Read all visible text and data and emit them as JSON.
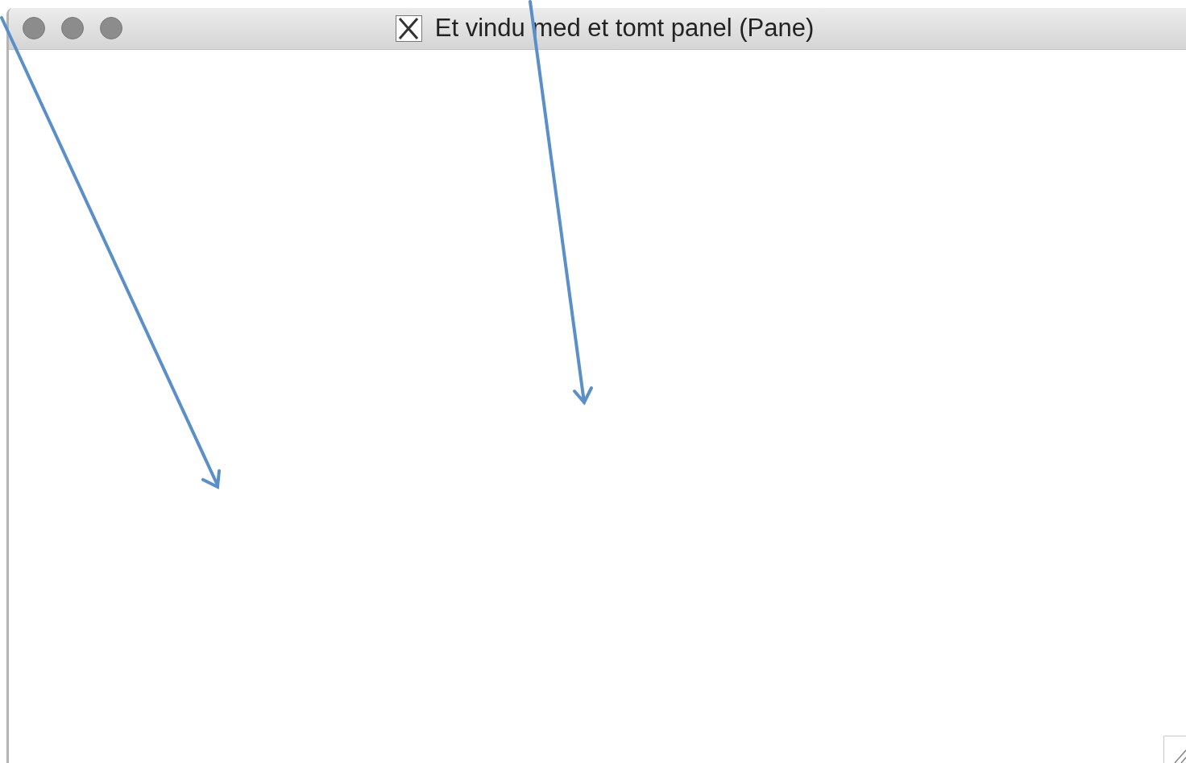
{
  "window": {
    "title": "Et vindu med et tomt panel (Pane)"
  }
}
